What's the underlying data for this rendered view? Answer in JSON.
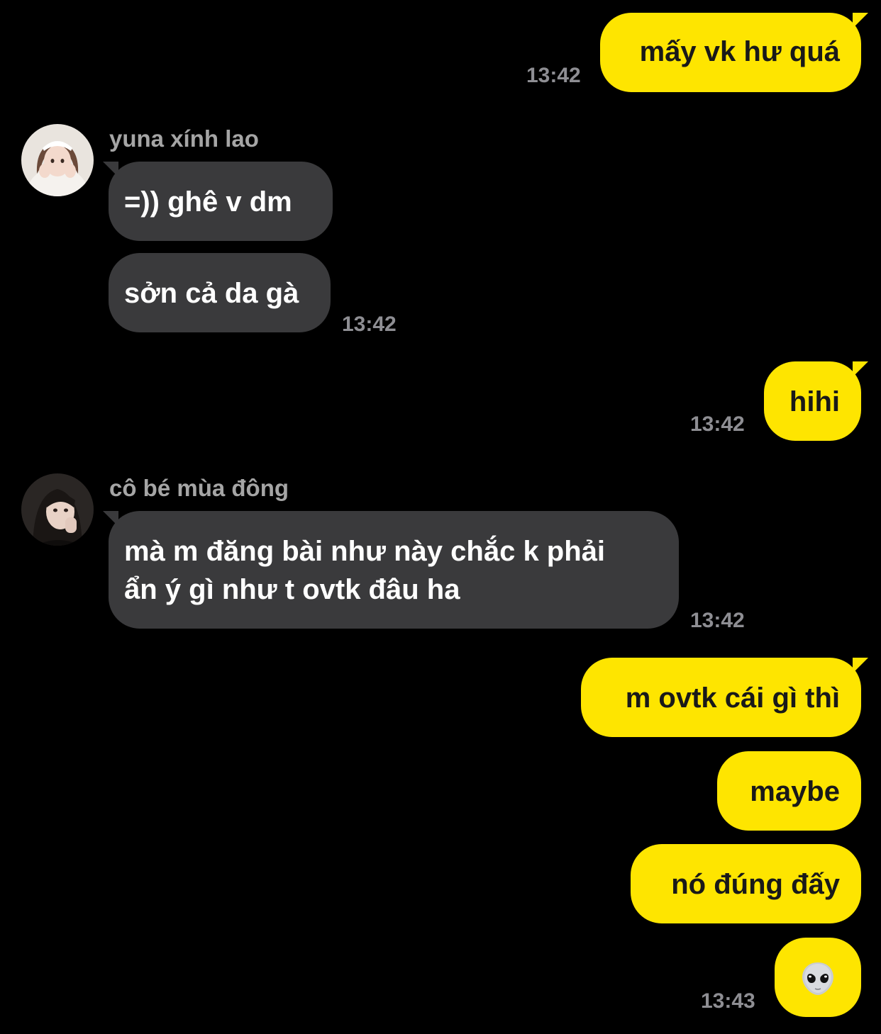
{
  "colors": {
    "background": "#000000",
    "outgoing_bubble": "#FEE500",
    "incoming_bubble": "#3a3a3c",
    "timestamp": "#8e8e93",
    "sender_name": "#a5a5a5"
  },
  "messages": [
    {
      "direction": "out",
      "text": "mấy vk hư quá",
      "time": "13:42"
    },
    {
      "direction": "in",
      "sender": "yuna xính lao",
      "avatar": "avatar-yuna",
      "texts": [
        "=)) ghê v dm",
        "sởn cả da gà"
      ],
      "time": "13:42"
    },
    {
      "direction": "out",
      "text": "hihi",
      "time": "13:42"
    },
    {
      "direction": "in",
      "sender": "cô bé mùa đông",
      "avatar": "avatar-co-be",
      "text_lines": [
        "mà m đăng bài như này chắc k phải",
        "ẩn ý gì như t ovtk đâu ha"
      ],
      "time": "13:42"
    },
    {
      "direction": "out",
      "texts": [
        "m ovtk cái gì thì",
        "maybe",
        "nó đúng đấy"
      ],
      "emoji": "alien-emoji-icon",
      "time": "13:43"
    }
  ]
}
